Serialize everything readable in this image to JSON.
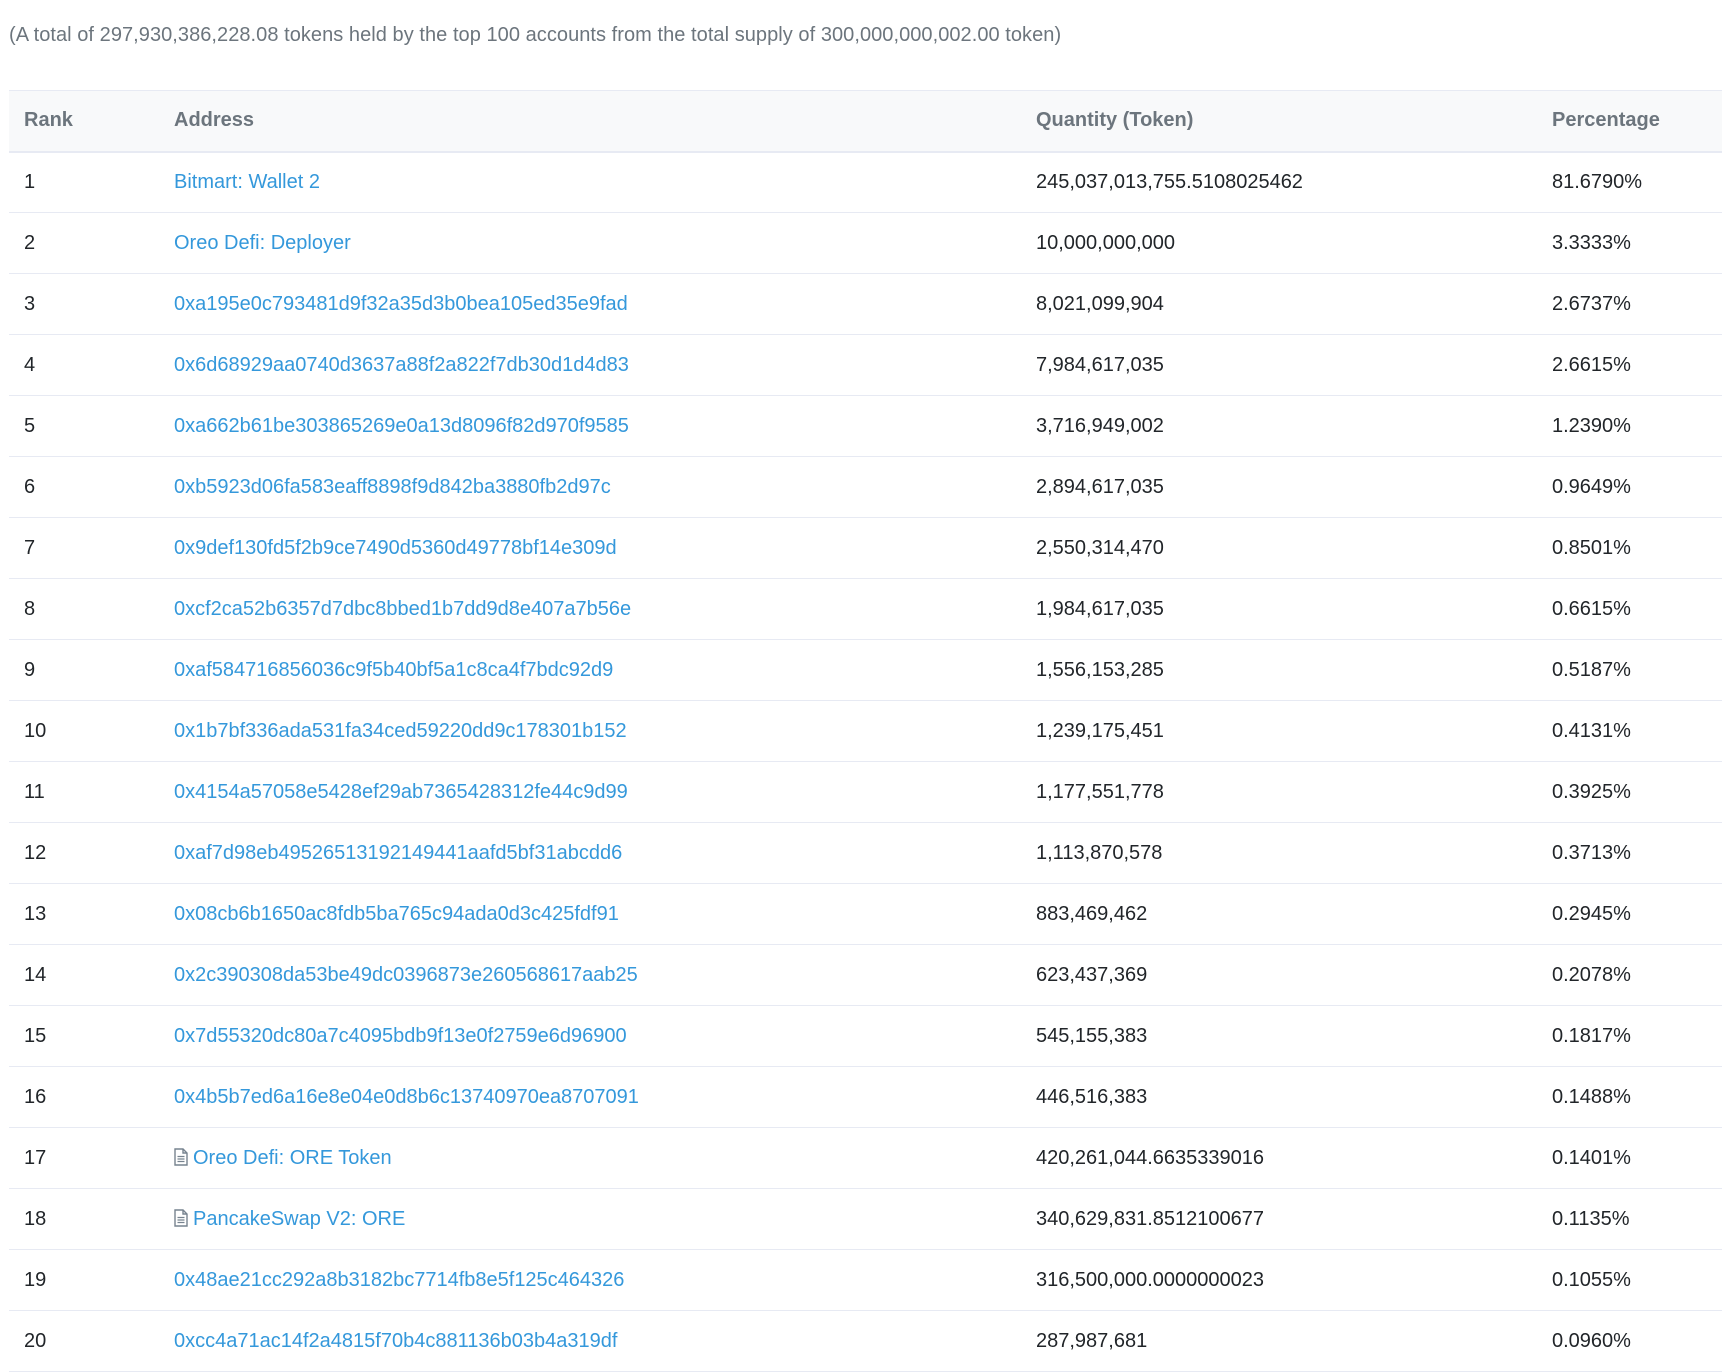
{
  "summary": "(A total of 297,930,386,228.08 tokens held by the top 100 accounts from the total supply of 300,000,000,002.00 token)",
  "table": {
    "headers": {
      "rank": "Rank",
      "address": "Address",
      "quantity": "Quantity (Token)",
      "percentage": "Percentage"
    },
    "rows": [
      {
        "rank": "1",
        "address": "Bitmart: Wallet 2",
        "contract": false,
        "quantity": "245,037,013,755.5108025462",
        "percentage": "81.6790%"
      },
      {
        "rank": "2",
        "address": "Oreo Defi: Deployer",
        "contract": false,
        "quantity": "10,000,000,000",
        "percentage": "3.3333%"
      },
      {
        "rank": "3",
        "address": "0xa195e0c793481d9f32a35d3b0bea105ed35e9fad",
        "contract": false,
        "quantity": "8,021,099,904",
        "percentage": "2.6737%"
      },
      {
        "rank": "4",
        "address": "0x6d68929aa0740d3637a88f2a822f7db30d1d4d83",
        "contract": false,
        "quantity": "7,984,617,035",
        "percentage": "2.6615%"
      },
      {
        "rank": "5",
        "address": "0xa662b61be303865269e0a13d8096f82d970f9585",
        "contract": false,
        "quantity": "3,716,949,002",
        "percentage": "1.2390%"
      },
      {
        "rank": "6",
        "address": "0xb5923d06fa583eaff8898f9d842ba3880fb2d97c",
        "contract": false,
        "quantity": "2,894,617,035",
        "percentage": "0.9649%"
      },
      {
        "rank": "7",
        "address": "0x9def130fd5f2b9ce7490d5360d49778bf14e309d",
        "contract": false,
        "quantity": "2,550,314,470",
        "percentage": "0.8501%"
      },
      {
        "rank": "8",
        "address": "0xcf2ca52b6357d7dbc8bbed1b7dd9d8e407a7b56e",
        "contract": false,
        "quantity": "1,984,617,035",
        "percentage": "0.6615%"
      },
      {
        "rank": "9",
        "address": "0xaf584716856036c9f5b40bf5a1c8ca4f7bdc92d9",
        "contract": false,
        "quantity": "1,556,153,285",
        "percentage": "0.5187%"
      },
      {
        "rank": "10",
        "address": "0x1b7bf336ada531fa34ced59220dd9c178301b152",
        "contract": false,
        "quantity": "1,239,175,451",
        "percentage": "0.4131%"
      },
      {
        "rank": "11",
        "address": "0x4154a57058e5428ef29ab7365428312fe44c9d99",
        "contract": false,
        "quantity": "1,177,551,778",
        "percentage": "0.3925%"
      },
      {
        "rank": "12",
        "address": "0xaf7d98eb4952651319214944 1aafd5bf31abcdd6",
        "contract": false,
        "quantity": "1,113,870,578",
        "percentage": "0.3713%"
      },
      {
        "rank": "13",
        "address": "0x08cb6b1650ac8fdb5ba765c94ada0d3c425fdf91",
        "contract": false,
        "quantity": "883,469,462",
        "percentage": "0.2945%"
      },
      {
        "rank": "14",
        "address": "0x2c390308da53be49dc0396873e260568617aab25",
        "contract": false,
        "quantity": "623,437,369",
        "percentage": "0.2078%"
      },
      {
        "rank": "15",
        "address": "0x7d55320dc80a7c4095bdb9f13e0f2759e6d96900",
        "contract": false,
        "quantity": "545,155,383",
        "percentage": "0.1817%"
      },
      {
        "rank": "16",
        "address": "0x4b5b7ed6a16e8e04e0d8b6c13740970ea8707091",
        "contract": false,
        "quantity": "446,516,383",
        "percentage": "0.1488%"
      },
      {
        "rank": "17",
        "address": "Oreo Defi: ORE Token",
        "contract": true,
        "quantity": "420,261,044.6635339016",
        "percentage": "0.1401%"
      },
      {
        "rank": "18",
        "address": "PancakeSwap V2: ORE",
        "contract": true,
        "quantity": "340,629,831.8512100677",
        "percentage": "0.1135%"
      },
      {
        "rank": "19",
        "address": "0x48ae21cc292a8b3182bc7714fb8e5f125c464326",
        "contract": false,
        "quantity": "316,500,000.0000000023",
        "percentage": "0.1055%"
      },
      {
        "rank": "20",
        "address": "0xcc4a71ac14f2a4815f70b4c881136b03b4a319df",
        "contract": false,
        "quantity": "287,987,681",
        "percentage": "0.0960%"
      }
    ]
  },
  "colors": {
    "link": "#3498db",
    "header_text": "#6c757d",
    "border": "#e7eaf3"
  },
  "icons": {
    "contract": "file-icon"
  }
}
